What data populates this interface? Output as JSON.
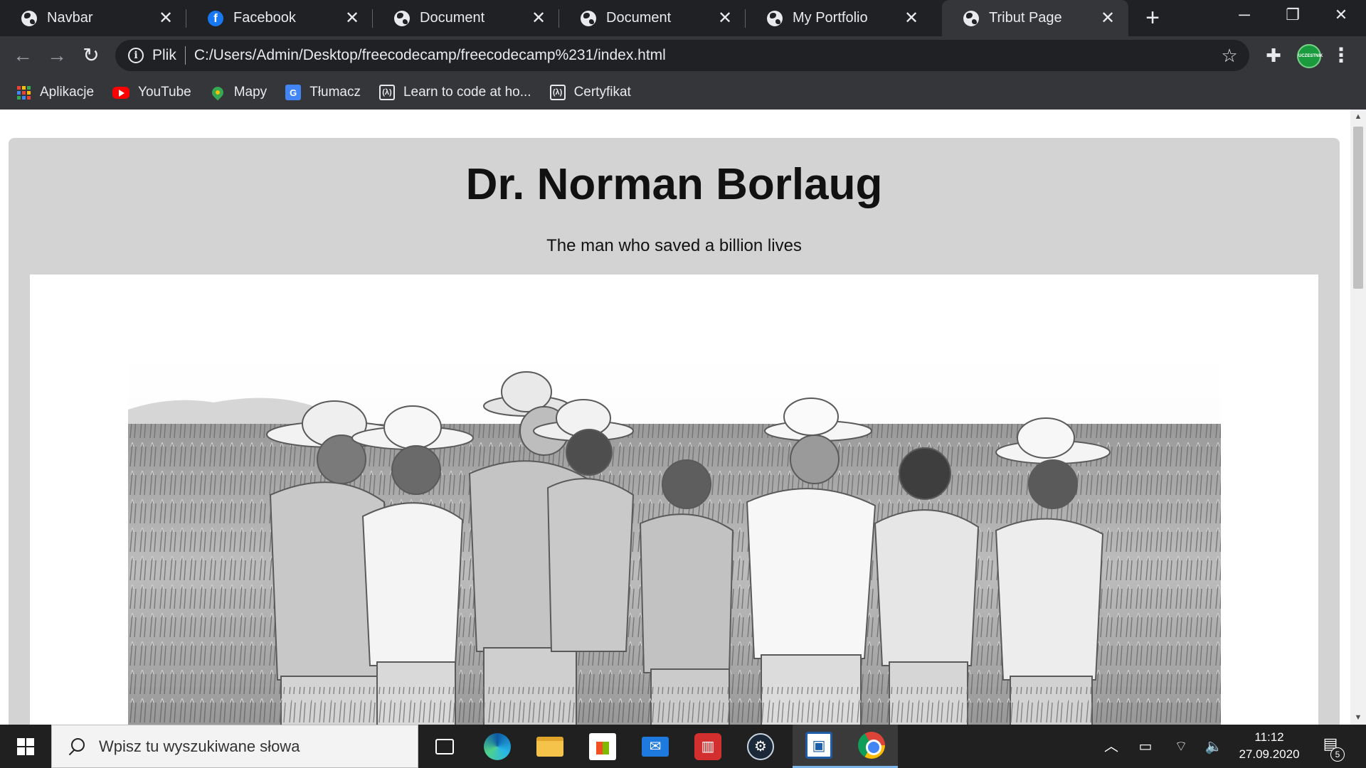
{
  "browser": {
    "tabs": [
      {
        "label": "Navbar",
        "favicon": "globe-icon"
      },
      {
        "label": "Facebook",
        "favicon": "facebook-icon"
      },
      {
        "label": "Document",
        "favicon": "globe-icon"
      },
      {
        "label": "Document",
        "favicon": "globe-icon"
      },
      {
        "label": "My Portfolio",
        "favicon": "globe-icon"
      },
      {
        "label": "Tribut Page",
        "favicon": "globe-icon",
        "active": true
      }
    ],
    "new_tab_glyph": "+",
    "close_glyph": "✕",
    "window_controls": {
      "minimize": "─",
      "restore": "❐",
      "close": "✕"
    },
    "nav": {
      "back": "←",
      "forward": "→",
      "reload": "↻"
    },
    "address": {
      "scheme_label": "Plik",
      "url": "C:/Users/Admin/Desktop/freecodecamp/freecodecamp%231/index.html"
    },
    "bookmarks": [
      {
        "label": "Aplikacje",
        "icon": "apps-grid-icon"
      },
      {
        "label": "YouTube",
        "icon": "youtube-icon"
      },
      {
        "label": "Mapy",
        "icon": "maps-pin-icon"
      },
      {
        "label": "Tłumacz",
        "icon": "google-translate-icon"
      },
      {
        "label": "Learn to code at ho...",
        "icon": "freecodecamp-icon"
      },
      {
        "label": "Certyfikat",
        "icon": "freecodecamp-icon"
      }
    ],
    "profile_badge_text": "UCZESTNIK"
  },
  "page": {
    "title": "Dr. Norman Borlaug",
    "subtitle": "The man who saved a billion lives",
    "image": {
      "description_icon": "photo-of-borlaug-with-farmers-in-wheat-field"
    }
  },
  "taskbar": {
    "search_placeholder": "Wpisz tu wyszukiwane słowa",
    "apps": [
      "task-view",
      "edge",
      "file-explorer",
      "microsoft-store",
      "mail",
      "reader",
      "steam",
      "snip-tool",
      "chrome"
    ],
    "clock": {
      "time": "11:12",
      "date": "27.09.2020"
    },
    "notification_count": "5"
  },
  "colors": {
    "tabstrip_bg": "#202124",
    "toolbar_bg": "#35363a",
    "page_container_bg": "#d3d3d3",
    "taskbar_bg": "#202020"
  }
}
